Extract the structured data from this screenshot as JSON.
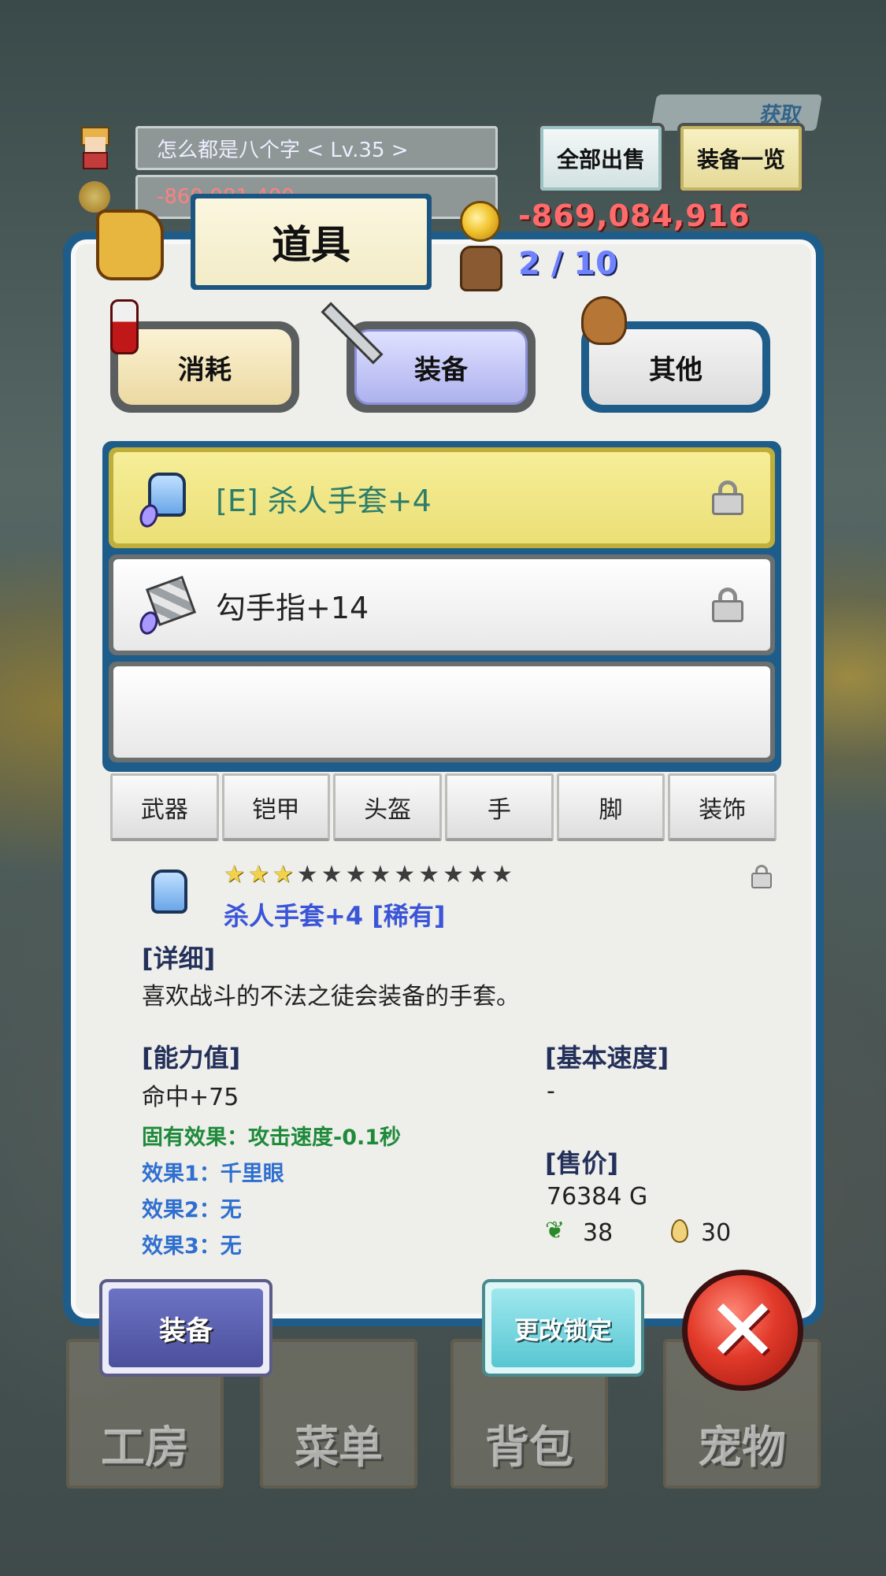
{
  "hud": {
    "player_name_level": "怎么都是八个字   < Lv.35 >",
    "gold_behind": "-869,081,400",
    "top_tag": "获取",
    "sell_all_label": "全部出售",
    "equip_list_label": "装备一览"
  },
  "inventory": {
    "title": "道具",
    "money": "-869,084,916",
    "capacity": "2 / 10",
    "categories": [
      {
        "label": "消耗",
        "icon": "potion-icon"
      },
      {
        "label": "装备",
        "icon": "sword-icon",
        "selected": true
      },
      {
        "label": "其他",
        "icon": "sack-icon"
      }
    ],
    "items": [
      {
        "label": "[E] 杀人手套+4",
        "icon": "glove-icon",
        "selected": true,
        "locked": true
      },
      {
        "label": "勾手指+14",
        "icon": "knuckle-icon",
        "selected": false,
        "locked": true
      },
      {
        "label": "",
        "icon": "",
        "selected": false,
        "locked": false
      }
    ],
    "slot_tabs": [
      "武器",
      "铠甲",
      "头盔",
      "手",
      "脚",
      "装饰"
    ]
  },
  "detail": {
    "stars_total": 12,
    "stars_filled": 3,
    "name": "杀人手套+4 [稀有]",
    "detail_header": "[详细]",
    "description": "喜欢战斗的不法之徒会装备的手套。",
    "stats_header": "[能力值]",
    "stat_line": "命中+75",
    "inherent_effect": "固有效果：攻击速度-0.1秒",
    "effect1": "效果1：千里眼",
    "effect2": "效果2：无",
    "effect3": "效果3：无",
    "speed_header": "[基本速度]",
    "speed_value": "-",
    "price_header": "[售价]",
    "price_value": "76384 G",
    "herb_count": "38",
    "drop_count": "30"
  },
  "actions": {
    "equip_label": "装备",
    "change_lock_label": "更改锁定",
    "close_label": "✕"
  },
  "background_nav": [
    "工房",
    "菜单",
    "背包",
    "宠物"
  ],
  "colors": {
    "panel_frame": "#1e5c8a",
    "money_red": "#ff6b6b",
    "capacity_blue": "#7083ff",
    "selected_row": "#ebdf77",
    "item_name_blue": "#3b55d8",
    "effect_green": "#1e8a3a",
    "effect_blue": "#2f6fd0",
    "close_red": "#e23a2a"
  }
}
